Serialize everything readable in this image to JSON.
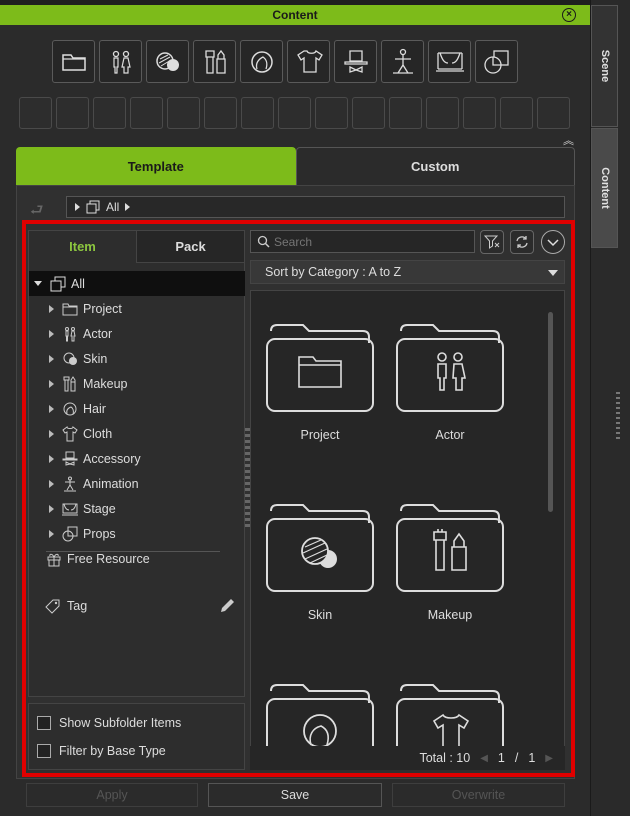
{
  "window": {
    "title": "Content"
  },
  "side_tabs": {
    "scene": "Scene",
    "content": "Content"
  },
  "main_tabs": {
    "template": "Template",
    "custom": "Custom"
  },
  "breadcrumb": {
    "current": "All"
  },
  "sub_tabs": {
    "item": "Item",
    "pack": "Pack"
  },
  "tree": {
    "root": "All",
    "items": [
      "Project",
      "Actor",
      "Skin",
      "Makeup",
      "Hair",
      "Cloth",
      "Accessory",
      "Animation",
      "Stage",
      "Props"
    ],
    "free_resource": "Free Resource",
    "tag": "Tag"
  },
  "options": {
    "show_subfolder": "Show Subfolder Items",
    "filter_base": "Filter by Base Type"
  },
  "search": {
    "placeholder": "Search"
  },
  "sort": {
    "label": "Sort by Category : A to Z"
  },
  "grid": {
    "items": [
      "Project",
      "Actor",
      "Skin",
      "Makeup"
    ]
  },
  "pager": {
    "total": "Total : 10",
    "page": "1",
    "sep": "/",
    "pages": "1"
  },
  "buttons": {
    "apply": "Apply",
    "save": "Save",
    "overwrite": "Overwrite"
  },
  "colors": {
    "accent": "#7dbb1a",
    "highlight": "#e00000"
  }
}
